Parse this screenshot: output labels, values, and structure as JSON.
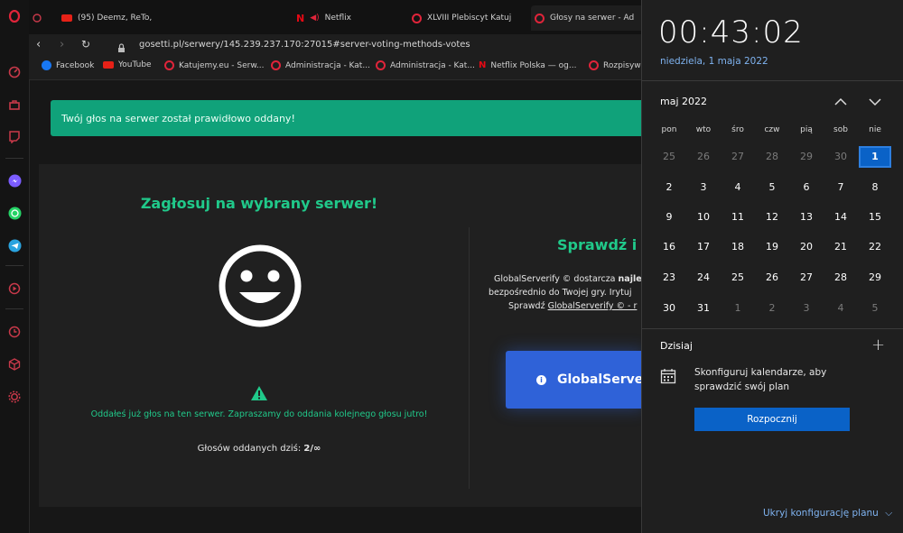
{
  "tabs": [
    {
      "title": "(95) Deemz, ReTo, "
    },
    {
      "title": "Netflix"
    },
    {
      "title": "XLVIII Plebiscyt Katuj"
    },
    {
      "title": "Głosy na serwer - Ad"
    }
  ],
  "address": {
    "url": "gosetti.pl/serwery/145.239.237.170:27015#server-voting-methods-votes"
  },
  "bookmarks": [
    {
      "label": "Facebook"
    },
    {
      "label": "YouTube"
    },
    {
      "label": "Katujemy.eu - Serw..."
    },
    {
      "label": "Administracja - Kat..."
    },
    {
      "label": "Administracja - Kat..."
    },
    {
      "label": "Netflix Polska — og..."
    },
    {
      "label": "Rozpisywan"
    }
  ],
  "alert": {
    "text": "Twój głos na serwer został prawidłowo oddany!"
  },
  "vote": {
    "heading": "Zagłosuj na wybrany serwer!",
    "warning": "Oddałeś już głos na ten serwer. Zapraszamy do oddania kolejnego głosu jutro!",
    "count_label": "Głosów oddanych dziś:",
    "count_value": "2/∞"
  },
  "promo": {
    "heading": "Sprawdź i p",
    "line1_a": "GlobalServerify © dostarcza ",
    "line1_b": "najle",
    "line2": "bezpośrednio do Twojej gry. Irytuj",
    "line3_a": "Sprawdź ",
    "line3_link": "GlobalServerify © - r",
    "button": "GlobalServer"
  },
  "clock": {
    "time": "00:43:02",
    "date": "niedziela, 1 maja 2022"
  },
  "calendar": {
    "month": "maj 2022",
    "weekdays": [
      "pon",
      "wto",
      "śro",
      "czw",
      "pią",
      "sob",
      "nie"
    ],
    "weeks": [
      [
        "25",
        "26",
        "27",
        "28",
        "29",
        "30",
        "1"
      ],
      [
        "2",
        "3",
        "4",
        "5",
        "6",
        "7",
        "8"
      ],
      [
        "9",
        "10",
        "11",
        "12",
        "13",
        "14",
        "15"
      ],
      [
        "16",
        "17",
        "18",
        "19",
        "20",
        "21",
        "22"
      ],
      [
        "23",
        "24",
        "25",
        "26",
        "27",
        "28",
        "29"
      ],
      [
        "30",
        "31",
        "1",
        "2",
        "3",
        "4",
        "5"
      ]
    ]
  },
  "agenda": {
    "heading": "Dzisiaj",
    "text1": "Skonfiguruj kalendarze, aby",
    "text2": "sprawdzić swój plan",
    "button": "Rozpocznij",
    "hide_link": "Ukryj konfigurację planu"
  },
  "colors": {
    "accent": "#0a62c7",
    "green": "#10a27a",
    "promo_button": "#2f62d8",
    "opera_red": "#e0243a"
  }
}
